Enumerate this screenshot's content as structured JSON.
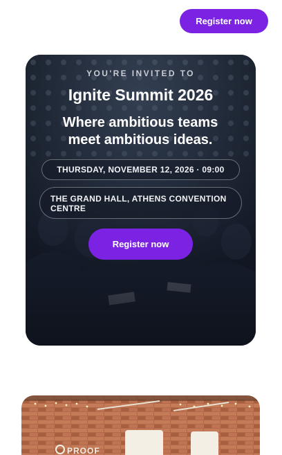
{
  "header": {
    "register_label": "Register now"
  },
  "hero": {
    "eyebrow": "YOU'RE INVITED TO",
    "title": "Ignite Summit 2026",
    "tagline": "Where ambitious teams meet ambitious ideas.",
    "date_time": "THURSDAY, NOVEMBER 12, 2026 · 09:00",
    "venue": "THE GRAND HALL, ATHENS CONVENTION CENTRE",
    "register_label": "Register now"
  },
  "venue_photo": {
    "sign_text": "PROOF"
  },
  "colors": {
    "accent": "#7b22e3",
    "hero_overlay": "#1c2433"
  }
}
